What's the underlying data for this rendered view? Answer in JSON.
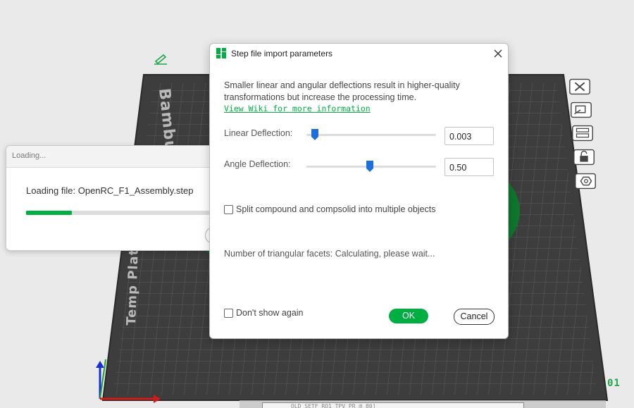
{
  "scene": {
    "plate_brand_text": "Bambu Smo",
    "plate_type_text": "Temp Plate",
    "plate_id": "01",
    "status_strip_text": "OLD SETF RO1  TPV PR      @ 80]",
    "colors": {
      "plate": "#3e3e3e",
      "grid": "#5b5b5b",
      "model": "#0a7a2a",
      "accent": "#00ae42"
    },
    "icons": {
      "edit": "pencil-icon",
      "toolbar": [
        "close-x-icon",
        "arrange-icon",
        "layers-icon",
        "lock-icon",
        "hexagon-icon"
      ]
    }
  },
  "loading_dialog": {
    "title": "Loading...",
    "message": "Loading file: OpenRC_F1_Assembly.step",
    "progress": 0.25
  },
  "step_dialog": {
    "title": "Step file import parameters",
    "description": "Smaller linear and angular deflections result in higher-quality transformations but increase the processing time.",
    "wiki_link": "View Wiki for more information",
    "linear": {
      "label": "Linear Deflection:",
      "value": "0.003",
      "slider_position": 0.04
    },
    "angle": {
      "label": "Angle Deflection:",
      "value": "0.50",
      "slider_position": 0.49
    },
    "split_checkbox": {
      "label": "Split compound and compsolid into multiple objects",
      "checked": false
    },
    "facets_text": "Number of triangular facets: Calculating, please wait...",
    "dont_show_checkbox": {
      "label": "Don't show again",
      "checked": false
    },
    "ok_label": "OK",
    "cancel_label": "Cancel"
  }
}
